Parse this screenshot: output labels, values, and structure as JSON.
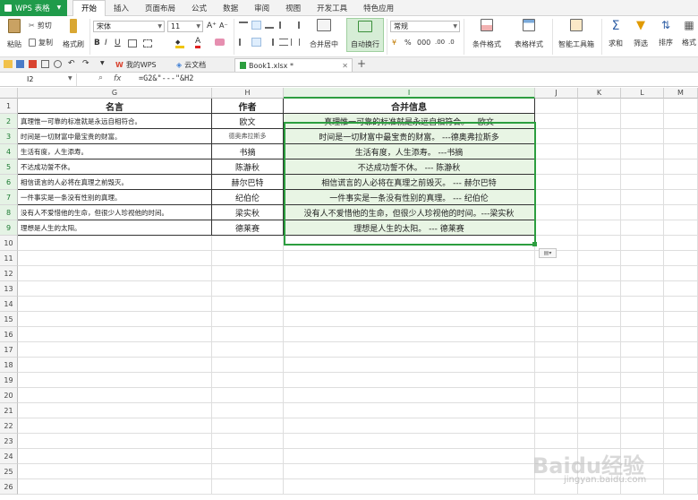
{
  "app": {
    "title": "WPS 表格"
  },
  "menu_tabs": [
    "开始",
    "插入",
    "页面布局",
    "公式",
    "数据",
    "审阅",
    "视图",
    "开发工具",
    "特色应用"
  ],
  "toolbar": {
    "paste": "粘贴",
    "cut": "剪切",
    "copy": "复制",
    "format_painter": "格式刷",
    "font_name": "宋体",
    "font_size": "11",
    "merge_center": "合并居中",
    "wrap_text": "自动换行",
    "number_format": "常规",
    "conditional_format": "条件格式",
    "table_style": "表格样式",
    "smart_toolbox": "智能工具箱",
    "sum": "求和",
    "filter": "筛选",
    "sort": "排序",
    "format": "格式"
  },
  "doc_tabs": [
    "我的WPS",
    "云文档",
    "Book1.xlsx *"
  ],
  "formula_bar": {
    "name_box": "I2",
    "fx": "fx",
    "formula": "=G2&\"---\"&H2"
  },
  "columns": [
    "G",
    "H",
    "I",
    "J",
    "K",
    "L",
    "M"
  ],
  "rows": [
    "1",
    "2",
    "3",
    "4",
    "5",
    "6",
    "7",
    "8",
    "9",
    "10",
    "11",
    "12",
    "13",
    "14",
    "15",
    "16",
    "17",
    "18",
    "19",
    "20",
    "21",
    "22",
    "23",
    "24",
    "25",
    "26"
  ],
  "headers": {
    "g": "名言",
    "h": "作者",
    "i": "合并信息"
  },
  "data_rows": [
    {
      "g": "真理惟一可靠的标准就是永远自相符合。",
      "h": "欧文",
      "i": "真理惟一可靠的标准就是永远自相符合。---欧文"
    },
    {
      "g": "时间是一切财富中最宝贵的财富。",
      "h": "德奥弗拉斯多",
      "i": "时间是一切财富中最宝贵的财富。 ---德奥弗拉斯多"
    },
    {
      "g": "生活有度，人生添寿。",
      "h": "书摘",
      "i": "生活有度，人生添寿。   ---书摘"
    },
    {
      "g": "不达成功誓不休。",
      "h": "陈瀞秋",
      "i": "不达成功誓不休。   ---  陈瀞秋"
    },
    {
      "g": "相信谎言的人必将在真理之前毁灭。",
      "h": "赫尔巴特",
      "i": "相信谎言的人必将在真理之前毁灭。   ---  赫尔巴特"
    },
    {
      "g": "一件事实是一条没有性别的真理。",
      "h": "纪伯伦",
      "i": "一件事实是一条没有性别的真理。   ---  纪伯伦"
    },
    {
      "g": "没有人不爱惜他的生命，但很少人珍视他的时间。",
      "h": "梁实秋",
      "i": "没有人不爱惜他的生命，但很少人珍视他的时间。---梁实秋"
    },
    {
      "g": "理想是人生的太阳。",
      "h": "德莱赛",
      "i": "理想是人生的太阳。   ---  德莱赛"
    }
  ],
  "watermark": {
    "brand": "Baidu经验",
    "url": "jingyan.baidu.com"
  }
}
